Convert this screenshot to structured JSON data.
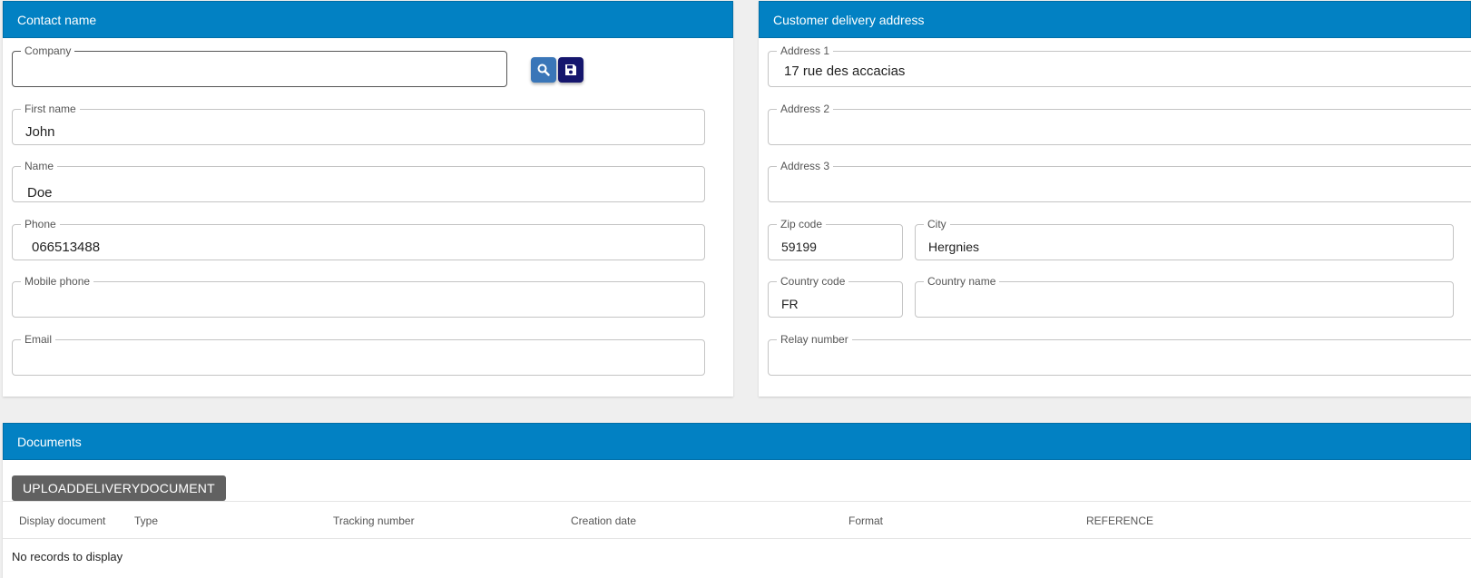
{
  "contact": {
    "title": "Contact name",
    "company": {
      "label": "Company",
      "value": ""
    },
    "first_name": {
      "label": "First name",
      "value": "John"
    },
    "name": {
      "label": "Name",
      "value": "Doe"
    },
    "phone": {
      "label": "Phone",
      "value": "066513488"
    },
    "mobile": {
      "label": "Mobile phone",
      "value": ""
    },
    "email": {
      "label": "Email",
      "value": ""
    },
    "buttons": {
      "search_icon": "search-icon",
      "save_icon": "save-icon"
    }
  },
  "delivery": {
    "title": "Customer delivery address",
    "address1": {
      "label": "Address 1",
      "value": "17 rue des accacias"
    },
    "address2": {
      "label": "Address 2",
      "value": ""
    },
    "address3": {
      "label": "Address 3",
      "value": ""
    },
    "zip": {
      "label": "Zip code",
      "value": "59199"
    },
    "city": {
      "label": "City",
      "value": "Hergnies"
    },
    "country_code": {
      "label": "Country code",
      "value": "FR"
    },
    "country_name": {
      "label": "Country name",
      "value": ""
    },
    "relay": {
      "label": "Relay number",
      "value": ""
    }
  },
  "documents": {
    "title": "Documents",
    "upload_label": "UPLOADDELIVERYDOCUMENT",
    "columns": [
      "Display document",
      "Type",
      "Tracking number",
      "Creation date",
      "Format",
      "REFERENCE"
    ],
    "empty_text": "No records to display"
  },
  "colors": {
    "header": "#0281c3",
    "search_button": "#3a76b8",
    "save_button": "#15166d",
    "upload_button": "#616161"
  }
}
